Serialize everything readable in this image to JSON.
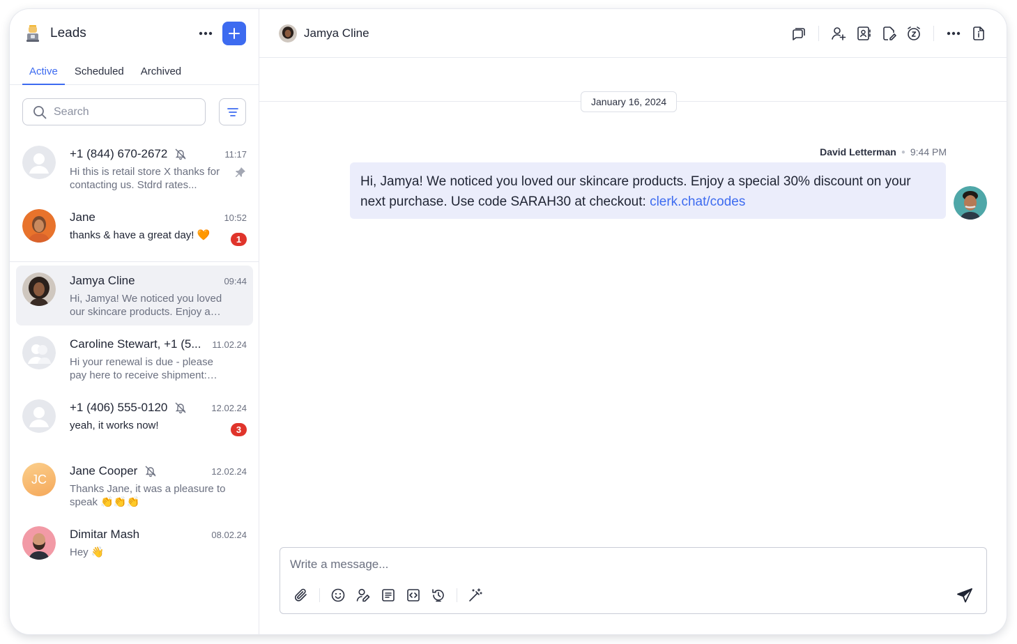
{
  "sidebar": {
    "title": "Leads",
    "tabs": [
      {
        "label": "Active"
      },
      {
        "label": "Scheduled"
      },
      {
        "label": "Archived"
      }
    ],
    "search": {
      "placeholder": "Search",
      "value": ""
    },
    "conversations": [
      {
        "name": "+1 (844) 670-2672",
        "time": "11:17",
        "preview": "Hi this is retail store X thanks for contacting us. Stdrd rates...",
        "muted": true,
        "pinned": true
      },
      {
        "name": "Jane",
        "time": "10:52",
        "preview": "thanks & have a great day! 🧡",
        "badge": "1"
      },
      {
        "name": "Jamya Cline",
        "time": "09:44",
        "preview": "Hi, Jamya! We noticed you loved our skincare products. Enjoy a spe...",
        "selected": true
      },
      {
        "name": "Caroline Stewart, +1 (5...",
        "time": "11.02.24",
        "preview": "Hi your renewal is due - please pay here to receive shipment: https://..."
      },
      {
        "name": "+1 (406) 555-0120",
        "time": "12.02.24",
        "preview": "yeah, it works now!",
        "muted": true,
        "badge": "3"
      },
      {
        "name": "Jane Cooper",
        "time": "12.02.24",
        "preview": "Thanks Jane, it was a pleasure to speak 👏👏👏",
        "muted": true,
        "initials": "JC"
      },
      {
        "name": "Dimitar Mash",
        "time": "08.02.24",
        "preview": "Hey 👋"
      }
    ]
  },
  "chat": {
    "contact_name": "Jamya Cline",
    "date_label": "January 16, 2024",
    "message": {
      "sender": "David Letterman",
      "time": "9:44 PM",
      "text": "Hi, Jamya! We noticed you loved our skincare products. Enjoy a special 30% discount on your next purchase. Use code SARAH30 at checkout: ",
      "link": "clerk.chat/codes"
    },
    "composer": {
      "placeholder": "Write a message...",
      "value": ""
    }
  },
  "colors": {
    "accent": "#3d6bf0",
    "badge": "#e0342b",
    "bubble": "#ebedfb",
    "selected_row": "#f0f1f5"
  }
}
